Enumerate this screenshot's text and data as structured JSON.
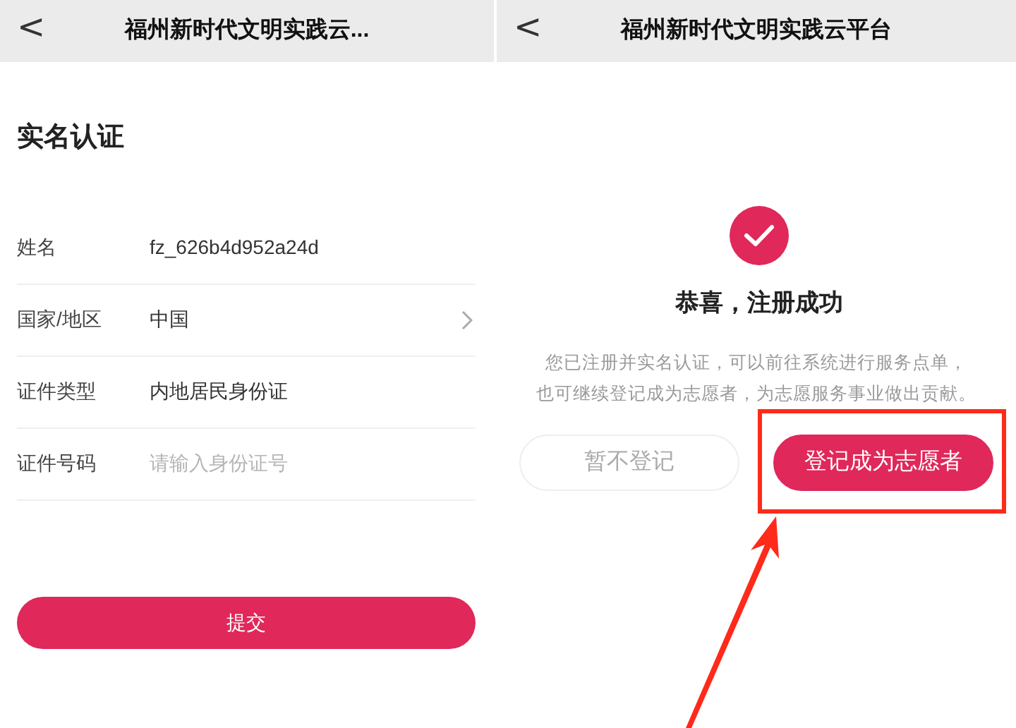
{
  "left_screen": {
    "header": {
      "back": "<",
      "title": "福州新时代文明实践云..."
    },
    "heading": "实名认证",
    "rows": [
      {
        "kind": "text",
        "label": "姓名",
        "value": "fz_626b4d952a24d"
      },
      {
        "kind": "select",
        "label": "国家/地区",
        "value": "中国"
      },
      {
        "kind": "text",
        "label": "证件类型",
        "value": "内地居民身份证"
      },
      {
        "kind": "input",
        "label": "证件号码",
        "placeholder": "请输入身份证号"
      }
    ],
    "submit_button": "提交"
  },
  "right_screen": {
    "header": {
      "back": "<",
      "title": "福州新时代文明实践云平台"
    },
    "success_title": "恭喜，注册成功",
    "message_lines": [
      "您已注册并实名认证，可以前往系统进行服务点单，",
      "也可继续登记成为志愿者，为志愿服务事业做出贡献。"
    ],
    "buttons": [
      {
        "kind": "outline",
        "label": "暂不登记",
        "highlighted": false
      },
      {
        "kind": "primary",
        "label": "登记成为志愿者",
        "highlighted": true
      }
    ]
  }
}
